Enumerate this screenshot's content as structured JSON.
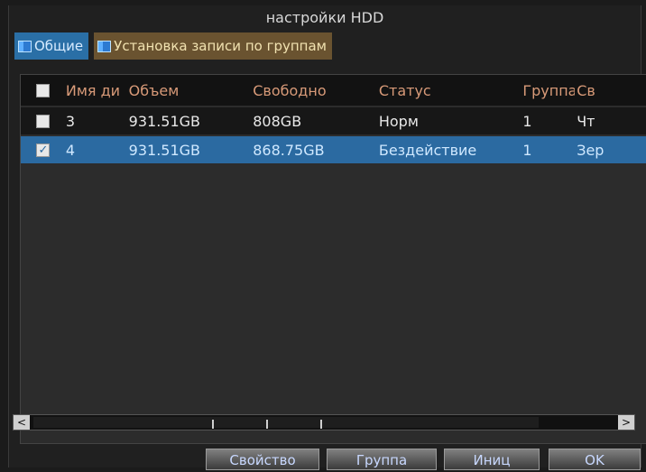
{
  "window": {
    "title": "настройки HDD"
  },
  "tabs": [
    {
      "label": "Общие",
      "active": true
    },
    {
      "label": "Установка записи по группам",
      "active": false
    }
  ],
  "table": {
    "headers": [
      "Имя ди",
      "Объем",
      "Свободно",
      "Статус",
      "Группа",
      "Св"
    ],
    "rows": [
      {
        "checked": false,
        "cells": [
          "3",
          "931.51GB",
          "808GB",
          "Норм",
          "1",
          "Чт"
        ]
      },
      {
        "checked": true,
        "cells": [
          "4",
          "931.51GB",
          "868.75GB",
          "Бездействие",
          "1",
          "Зер"
        ]
      }
    ]
  },
  "scrollbar": {
    "left_arrow": "<",
    "right_arrow": ">"
  },
  "buttons": {
    "property": "Свойство",
    "group": "Группа",
    "init": "Иниц",
    "ok": "OK"
  },
  "colors": {
    "active_tab": "#2a6fa6",
    "inactive_tab": "#6a5330",
    "selected_row": "#2b6aa1",
    "header_text": "#d89a78"
  },
  "icons": [
    "tab-flag-icon",
    "checkbox-icon",
    "scroll-left-icon",
    "scroll-right-icon"
  ]
}
